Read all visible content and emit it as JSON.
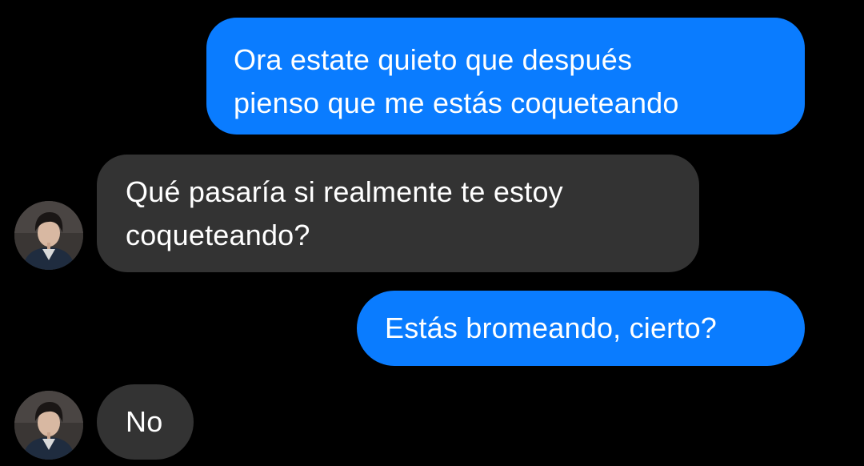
{
  "messages": [
    {
      "direction": "outgoing",
      "lines": [
        "Ora estate quieto que después",
        "pienso que me estás coqueteando"
      ]
    },
    {
      "direction": "incoming",
      "lines": [
        "Qué pasaría si realmente te estoy",
        "coqueteando?"
      ]
    },
    {
      "direction": "outgoing",
      "lines": [
        "Estás bromeando, cierto?"
      ]
    },
    {
      "direction": "incoming",
      "lines": [
        "No"
      ]
    }
  ],
  "colors": {
    "background": "#000000",
    "outgoing_bubble": "#0a7cff",
    "incoming_bubble": "#333333",
    "text": "#ffffff"
  },
  "icons": {
    "contact_avatar": "contact-avatar-photo"
  }
}
